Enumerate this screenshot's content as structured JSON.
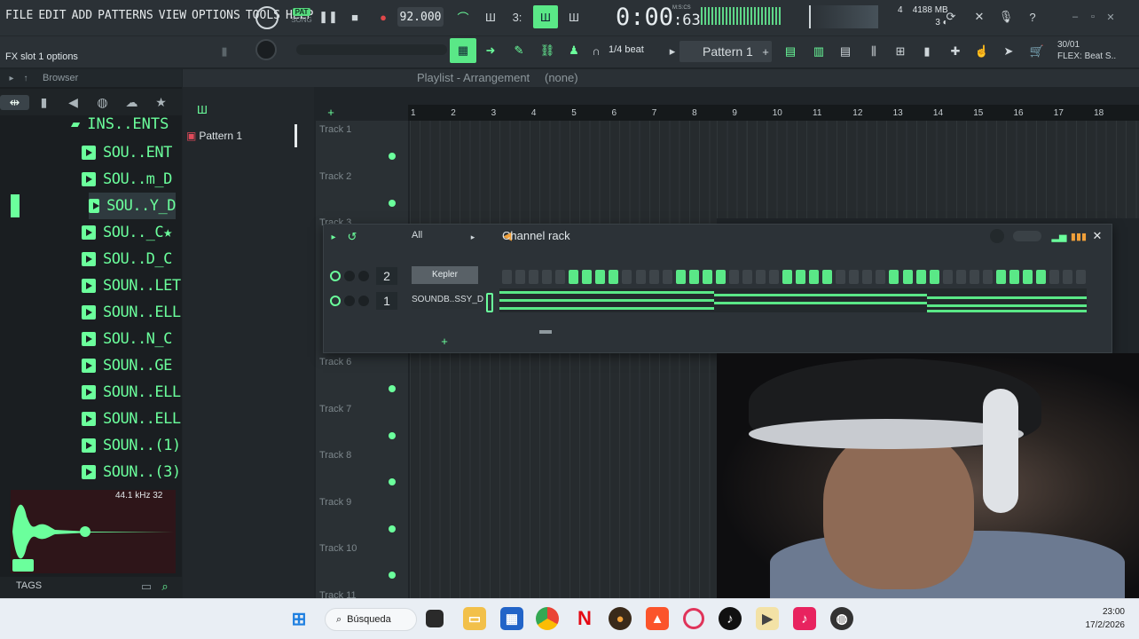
{
  "menu": [
    "FILE",
    "EDIT",
    "ADD",
    "PATTERNS",
    "VIEW",
    "OPTIONS",
    "TOOLS",
    "HELP"
  ],
  "transport": {
    "pat": "PAT",
    "song": "SONG",
    "tempo": "92.000",
    "time_main": "0:00",
    "time_sub": "63",
    "time_label": "M:S:CS"
  },
  "cpu": {
    "voices": "4",
    "memory": "4188 MB",
    "polyphony": "3"
  },
  "hint": "FX slot 1 options",
  "snap": "1/4 beat",
  "pattern_selector": "Pattern 1",
  "flex": {
    "line1": "30/01",
    "line2": "FLEX: Beat S.."
  },
  "browser": {
    "title": "Browser",
    "folder": "INS..ENTS",
    "items": [
      "SOU..ENT",
      "SOU..m_D",
      "SOU..Y_D",
      "SOU.._C★",
      "SOU..D_C",
      "SOUN..LET",
      "SOUN..ELL",
      "SOU..N_C",
      "SOUN..GE",
      "SOUN..ELL",
      "SOUN..ELL",
      "SOUN..(1)",
      "SOUN..(3)"
    ],
    "selected_index": 2,
    "sample_info": "44.1 kHz 32",
    "tags_label": "TAGS"
  },
  "playlist": {
    "title": "Playlist - Arrangement",
    "arrangement": "(none)",
    "pattern_item": "Pattern 1",
    "ruler": [
      "1",
      "2",
      "3",
      "4",
      "5",
      "6",
      "7",
      "8",
      "9",
      "10",
      "11",
      "12",
      "13",
      "14",
      "15",
      "16",
      "17",
      "18"
    ],
    "tracks_top": [
      "Track 1",
      "Track 2",
      "Track 3"
    ],
    "tracks_bottom": [
      "Track 6",
      "Track 7",
      "Track 8",
      "Track 9",
      "Track 10",
      "Track 11"
    ]
  },
  "channel_rack": {
    "title": "Channel rack",
    "filter": "All",
    "channels": [
      {
        "number": "2",
        "name": "Kepler"
      },
      {
        "number": "1",
        "name": "SOUNDB..SSY_D"
      }
    ],
    "kepler_steps": [
      0,
      0,
      0,
      0,
      0,
      1,
      1,
      1,
      1,
      0,
      0,
      0,
      0,
      1,
      1,
      1,
      1,
      0,
      0,
      0,
      0,
      1,
      1,
      1,
      1,
      0,
      0,
      0,
      0,
      1,
      1,
      1,
      1,
      0,
      0,
      0,
      0,
      1,
      1,
      1,
      1,
      0,
      0,
      0
    ]
  },
  "taskbar": {
    "search_placeholder": "Búsqueda",
    "time": "23:00",
    "date": "17/2/2026"
  },
  "colors": {
    "accent": "#6bff9c",
    "step_on": "#5ae887",
    "panel": "#2b3136"
  }
}
